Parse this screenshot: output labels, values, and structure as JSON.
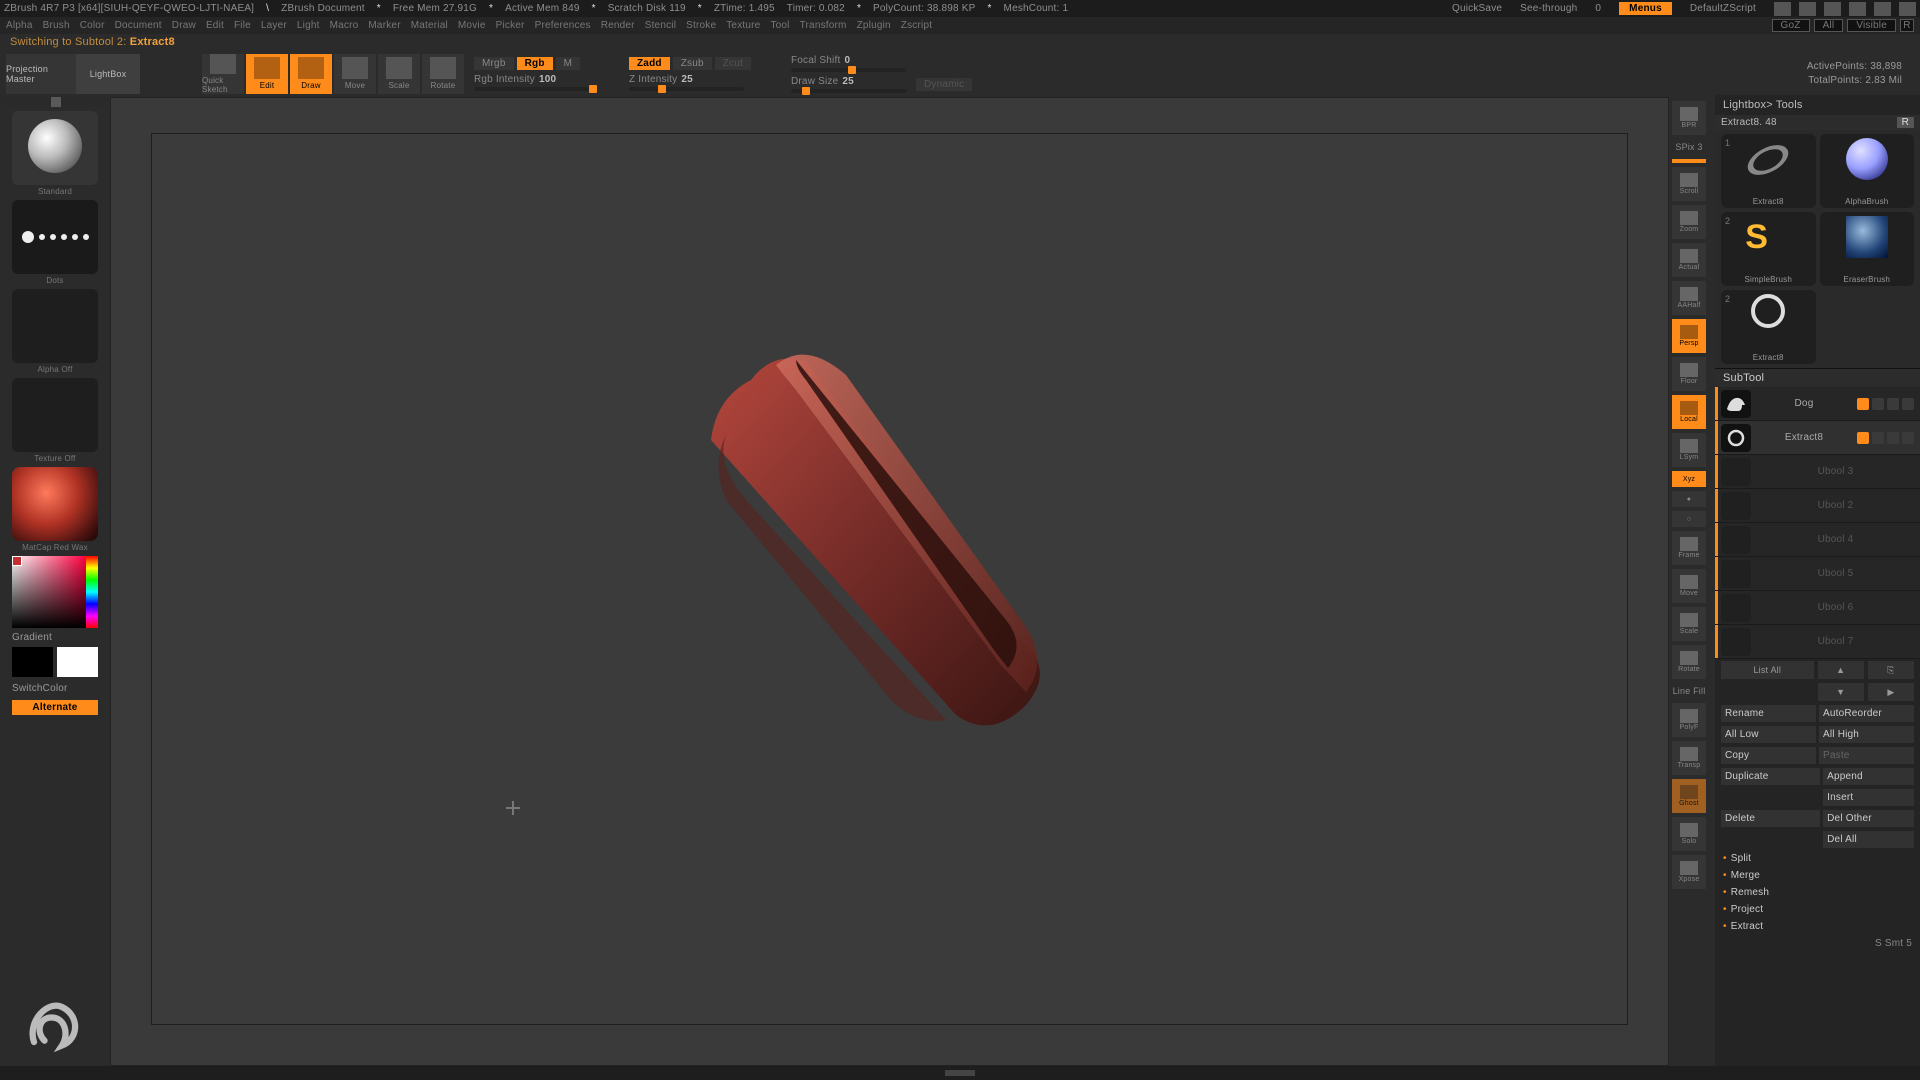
{
  "title": {
    "app": "ZBrush 4R7 P3 [x64][SIUH-QEYF-QWEO-LJTI-NAEA]",
    "doc": "ZBrush Document",
    "freeMem": "Free Mem 27.91G",
    "activeMem": "Active Mem 849",
    "scratch": "Scratch Disk 119",
    "ztime": "ZTime: 1.495",
    "timer": "Timer: 0.082",
    "polycount": "PolyCount: 38.898 KP",
    "meshcount": "MeshCount: 1",
    "quicksave": "QuickSave",
    "seethrough": "See-through",
    "seethroughVal": "0",
    "menus": "Menus",
    "script": "DefaultZScript"
  },
  "menu": {
    "items": [
      "Alpha",
      "Brush",
      "Color",
      "Document",
      "Draw",
      "Edit",
      "File",
      "Layer",
      "Light",
      "Macro",
      "Marker",
      "Material",
      "Movie",
      "Picker",
      "Preferences",
      "Render",
      "Stencil",
      "Stroke",
      "Texture",
      "Tool",
      "Transform",
      "Zplugin",
      "Zscript"
    ],
    "rchips": {
      "goz": "GoZ",
      "all": "All",
      "visible": "Visible",
      "r": "R"
    }
  },
  "status": {
    "prefix": "Switching to Subtool 2:",
    "name": "Extract8"
  },
  "toolbar": {
    "projMaster": "Projection Master",
    "lightbox": "LightBox",
    "quicksketch": "Quick Sketch",
    "edit": "Edit",
    "draw": "Draw",
    "move": "Move",
    "scale": "Scale",
    "rotate": "Rotate",
    "mrgb": "Mrgb",
    "rgb": "Rgb",
    "m": "M",
    "rgbInt": "Rgb Intensity",
    "rgbIntVal": "100",
    "zadd": "Zadd",
    "zsub": "Zsub",
    "zcut": "Zcut",
    "zInt": "Z Intensity",
    "zIntVal": "25",
    "focal": "Focal Shift",
    "focalVal": "0",
    "drawSize": "Draw Size",
    "drawSizeVal": "25",
    "dynamic": "Dynamic",
    "active": "ActivePoints:",
    "activeVal": "38,898",
    "total": "TotalPoints:",
    "totalVal": "2.83 Mil"
  },
  "left": {
    "brush": "Standard",
    "stroke": "Dots",
    "alpha": "Alpha Off",
    "texture": "Texture Off",
    "material": "MatCap Red Wax",
    "gradient": "Gradient",
    "switch": "SwitchColor",
    "alternate": "Alternate"
  },
  "rail": {
    "bpr": "BPR",
    "spix": "SPix 3",
    "scroll": "Scroll",
    "zoom": "Zoom",
    "actual": "Actual",
    "aahalf": "AAHalf",
    "persp": "Persp",
    "floor": "Floor",
    "local": "Local",
    "lsym": "LSym",
    "xyz": "Xyz",
    "frame": "Frame",
    "move": "Move",
    "scale": "Scale",
    "rotate": "Rotate",
    "linefill": "Line Fill",
    "polyf": "PolyF",
    "transp": "Transp",
    "ghost": "Ghost",
    "solo": "Solo",
    "xpose": "Xpose"
  },
  "right": {
    "lightbox": "Lightbox> Tools",
    "toolLabel": "Extract8. 48",
    "R": "R",
    "thumbs": {
      "extract": "Extract8",
      "alpha": "AlphaBrush",
      "simple": "SimpleBrush",
      "eraser": "EraserBrush",
      "extract2": "Extract8"
    },
    "subtoolHead": "SubTool",
    "subtools": [
      {
        "name": "Dog",
        "sel": false,
        "ghost": false
      },
      {
        "name": "Extract8",
        "sel": true,
        "ghost": false
      },
      {
        "name": "Ubool 3",
        "sel": false,
        "ghost": true
      },
      {
        "name": "Ubool 2",
        "sel": false,
        "ghost": true
      },
      {
        "name": "Ubool 4",
        "sel": false,
        "ghost": true
      },
      {
        "name": "Ubool 5",
        "sel": false,
        "ghost": true
      },
      {
        "name": "Ubool 6",
        "sel": false,
        "ghost": true
      },
      {
        "name": "Ubool 7",
        "sel": false,
        "ghost": true
      }
    ],
    "listAll": "List All",
    "btns": {
      "rename": "Rename",
      "autoreorder": "AutoReorder",
      "alllow": "All Low",
      "allhigh": "All High",
      "copy": "Copy",
      "paste": "Paste",
      "duplicate": "Duplicate",
      "append": "Append",
      "insert": "Insert",
      "delete": "Delete",
      "delother": "Del Other",
      "delall": "Del All"
    },
    "acc": {
      "split": "Split",
      "merge": "Merge",
      "remesh": "Remesh",
      "project": "Project",
      "extract": "Extract"
    },
    "footer": "S  Smt 5"
  }
}
